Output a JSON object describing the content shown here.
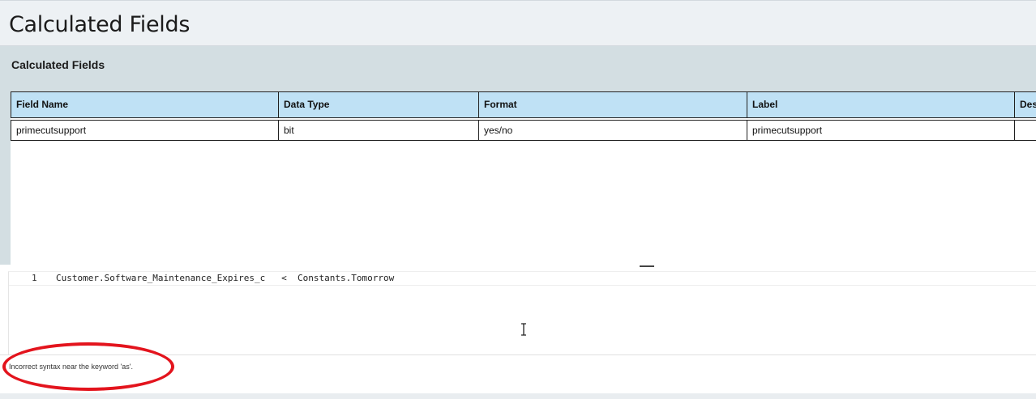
{
  "page": {
    "title": "Calculated Fields"
  },
  "panel": {
    "title": "Calculated Fields"
  },
  "grid": {
    "columns": [
      "Field Name",
      "Data Type",
      "Format",
      "Label",
      "Desc"
    ],
    "rows": [
      [
        "primecutsupport",
        "bit",
        "yes/no",
        "primecutsupport",
        ""
      ]
    ]
  },
  "editor": {
    "lines": [
      {
        "number": "1",
        "code": "Customer.Software_Maintenance_Expires_c   <  Constants.Tomorrow"
      }
    ]
  },
  "error": {
    "message": "Incorrect syntax near the keyword 'as'."
  },
  "colors": {
    "header_bg": "#edf1f4",
    "panel_bg": "#d3dee2",
    "grid_header_bg": "#bfe1f5",
    "annotation": "#e3141d"
  },
  "icons": {
    "row_marker": "row-pointer-icon",
    "cursor": "text-cursor-icon"
  }
}
